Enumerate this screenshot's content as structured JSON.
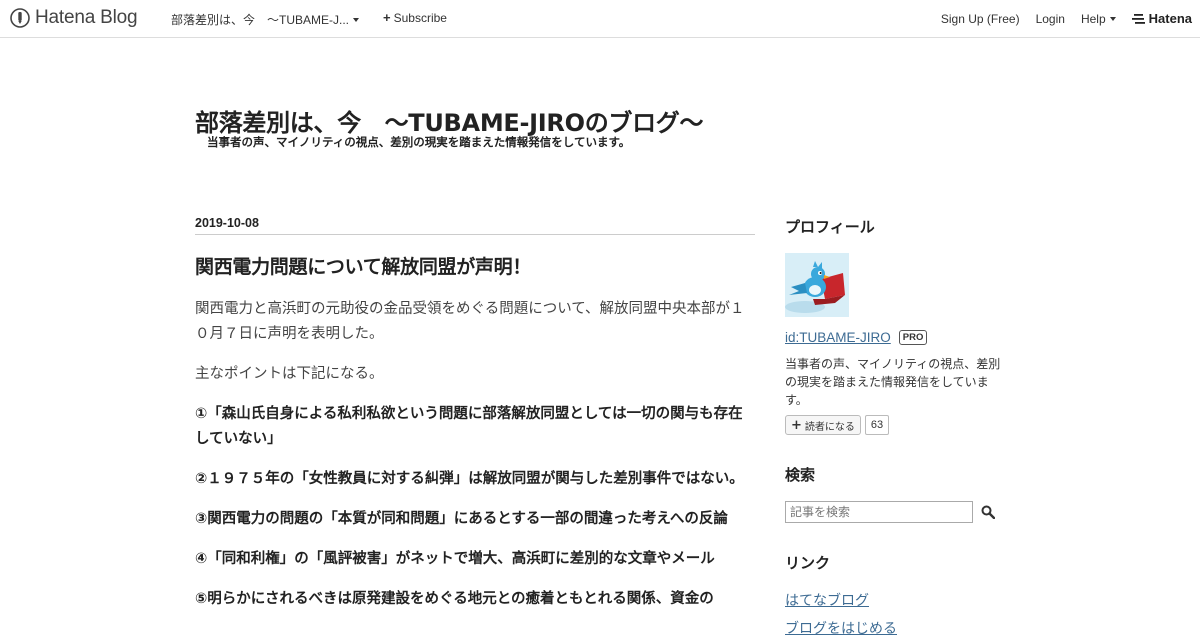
{
  "topbar": {
    "logo_text": "Hatena Blog",
    "blog_selector": "部落差別は、今　～TUBAME-J...",
    "subscribe": "Subscribe",
    "signup": "Sign Up (Free)",
    "login": "Login",
    "help": "Help",
    "hatena": "Hatena"
  },
  "blog": {
    "title": "部落差別は、今　～TUBAME-JIROのブログ～",
    "description": "当事者の声、マイノリティの視点、差別の現実を踏まえた情報発信をしています。"
  },
  "entry": {
    "date": "2019-10-08",
    "title": "関西電力問題について解放同盟が声明！",
    "paragraphs": [
      "関西電力と高浜町の元助役の金品受領をめぐる問題について、解放同盟中央本部が１０月７日に声明を表明した。",
      "主なポイントは下記になる。"
    ],
    "points": [
      "①「森山氏自身による私利私欲という問題に部落解放同盟としては一切の関与も存在していない」",
      "②１９７５年の「女性教員に対する糾弾」は解放同盟が関与した差別事件ではない。",
      "③関西電力の問題の「本質が同和問題」にあるとする一部の間違った考えへの反論",
      "④「同和利権」の「風評被害」がネットで増大、高浜町に差別的な文章やメール",
      "⑤明らかにされるべきは原発建設をめぐる地元との癒着ともとれる関係、資金の"
    ]
  },
  "sidebar": {
    "profile_title": "プロフィール",
    "user_id": "id:TUBAME-JIRO",
    "pro_badge": "PRO",
    "profile_desc": "当事者の声、マイノリティの視点、差別の現実を踏まえた情報発信をしています。",
    "reader_button": "読者になる",
    "reader_count": "63",
    "search_title": "検索",
    "search_placeholder": "記事を検索",
    "links_title": "リンク",
    "links": [
      "はてなブログ",
      "ブログをはじめる"
    ]
  },
  "colors": {
    "link": "#3d6b93",
    "text": "#222222",
    "border": "#dddddd"
  }
}
